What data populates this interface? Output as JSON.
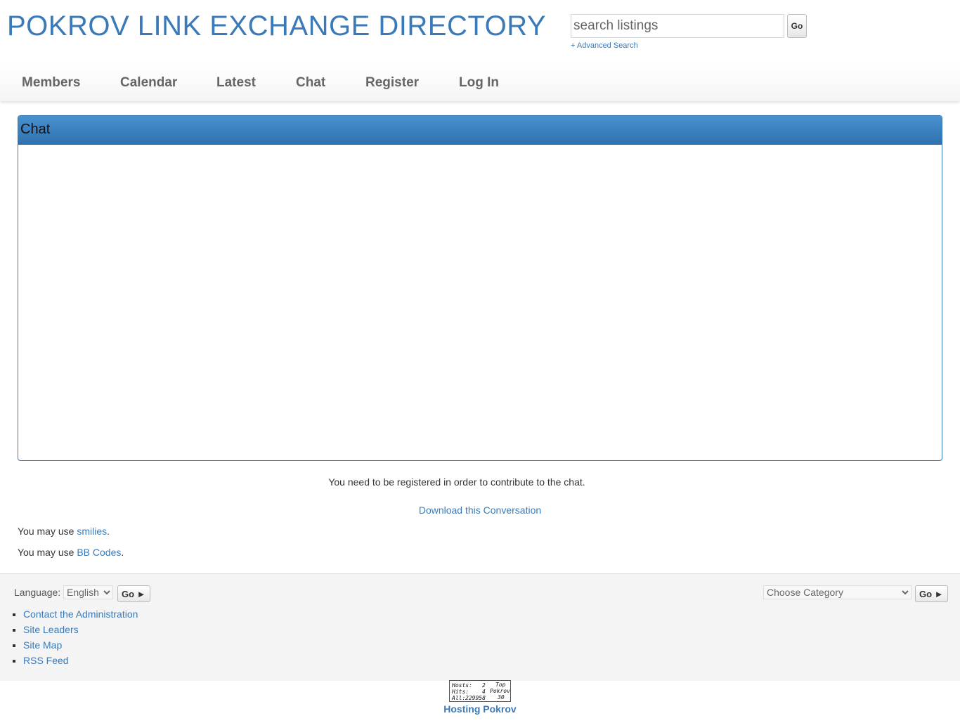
{
  "header": {
    "title": "POKROV LINK EXCHANGE DIRECTORY",
    "search_placeholder": "search listings",
    "search_button": "Go",
    "advanced_search": "+ Advanced Search"
  },
  "nav": {
    "items": [
      {
        "label": "Members"
      },
      {
        "label": "Calendar"
      },
      {
        "label": "Latest"
      },
      {
        "label": "Chat"
      },
      {
        "label": "Register"
      },
      {
        "label": "Log In"
      }
    ]
  },
  "chat": {
    "title": "Chat",
    "register_notice": "You need to be registered in order to contribute to the chat.",
    "download_link": "Download this Conversation",
    "smilies_prefix": "You may use ",
    "smilies_link": "smilies",
    "smilies_suffix": ".",
    "bbcodes_prefix": "You may use ",
    "bbcodes_link": "BB Codes",
    "bbcodes_suffix": "."
  },
  "footer": {
    "language_label": "Language:",
    "language_value": "English",
    "language_go": "Go ►",
    "category_placeholder": "Choose Category",
    "category_go": "Go ►",
    "links": [
      {
        "label": "Contact the Administration"
      },
      {
        "label": "Site Leaders"
      },
      {
        "label": "Site Map"
      },
      {
        "label": "RSS Feed"
      }
    ]
  },
  "counter": {
    "hosts_label": "Hosts:",
    "hosts_value": "2",
    "hits_label": "Hits:",
    "hits_value": "4",
    "all_label": "All:",
    "all_value": "229958",
    "top_line1": "Top",
    "top_line2": "Pokrov",
    "top_line3": "30"
  },
  "bottom": {
    "hosting_link": "Hosting Pokrov"
  },
  "colors": {
    "accent": "#3a7ab8",
    "chat_header": "#3a80c2",
    "footer_bg": "#f4f4f4"
  }
}
